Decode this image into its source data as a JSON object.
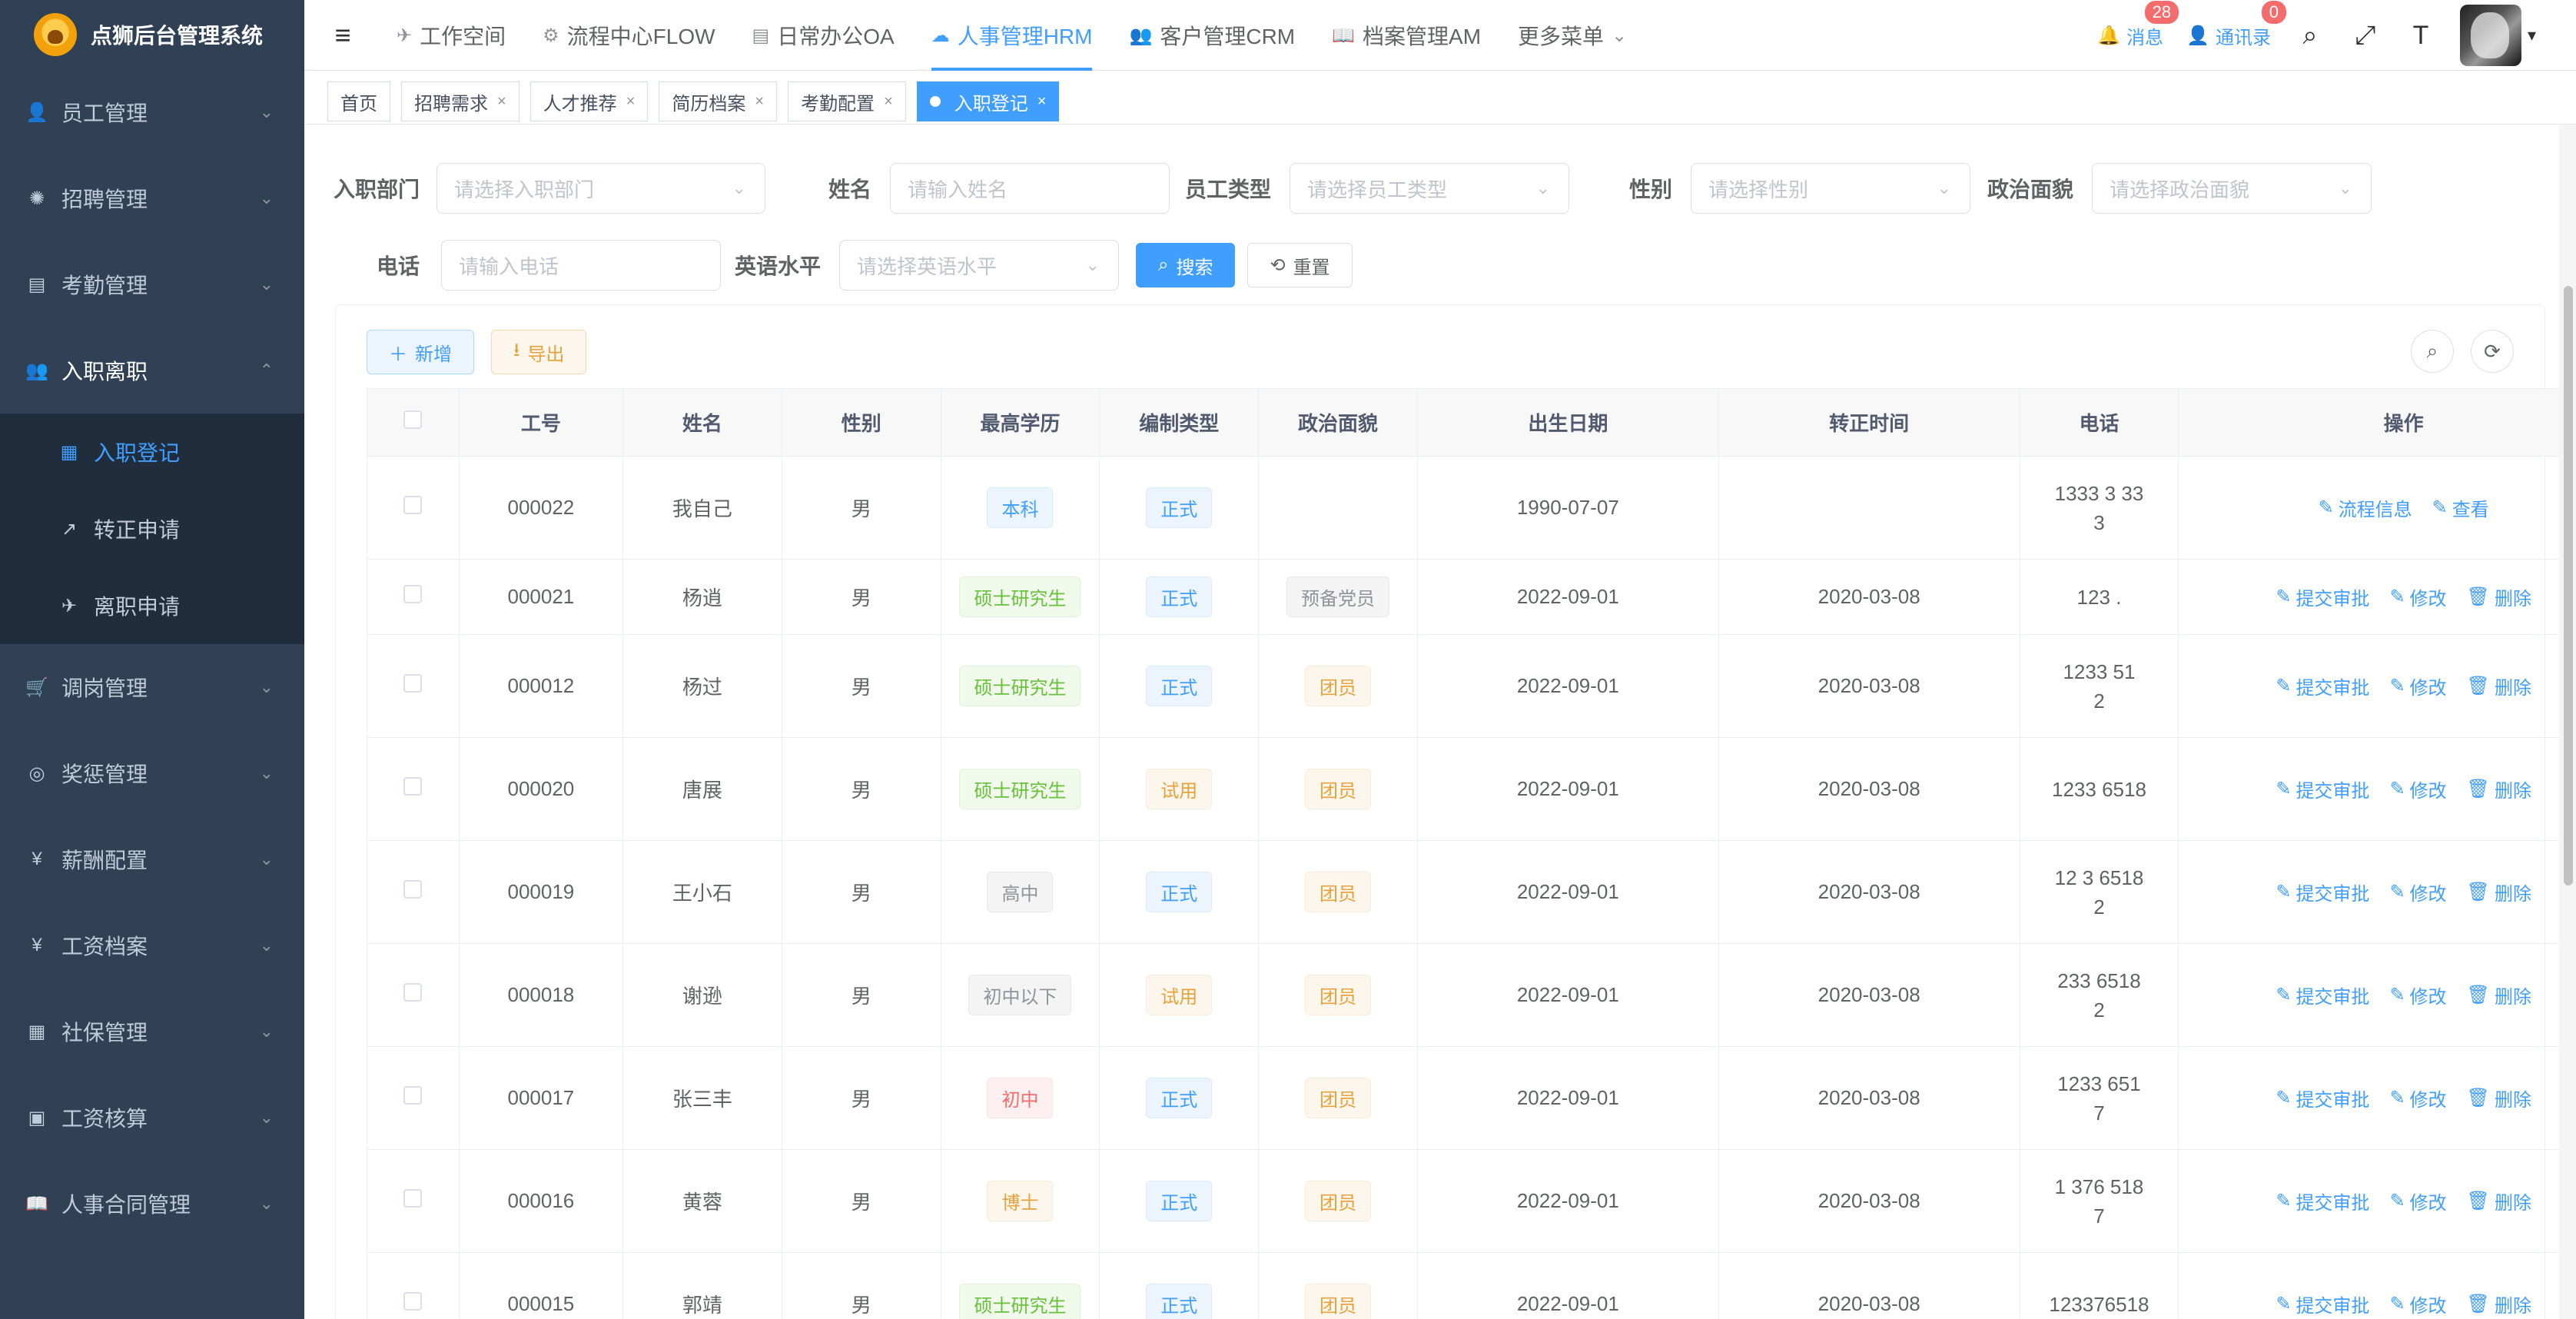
{
  "app": {
    "title": "点狮后台管理系统"
  },
  "sidebar": {
    "items": [
      {
        "label": "员工管理",
        "icon": "user-icon"
      },
      {
        "label": "招聘管理",
        "icon": "bug-icon"
      },
      {
        "label": "考勤管理",
        "icon": "form-icon"
      },
      {
        "label": "入职离职",
        "icon": "peoples-icon",
        "expanded": true,
        "children": [
          {
            "label": "入职登记",
            "icon": "calendar-icon",
            "active": true
          },
          {
            "label": "转正申请",
            "icon": "external-link-icon"
          },
          {
            "label": "离职申请",
            "icon": "paper-plane-icon"
          }
        ]
      },
      {
        "label": "调岗管理",
        "icon": "cart-icon"
      },
      {
        "label": "奖惩管理",
        "icon": "chrome-icon"
      },
      {
        "label": "薪酬配置",
        "icon": "yen-icon"
      },
      {
        "label": "工资档案",
        "icon": "yen-icon"
      },
      {
        "label": "社保管理",
        "icon": "grid-icon"
      },
      {
        "label": "工资核算",
        "icon": "calendar-icon"
      },
      {
        "label": "人事合同管理",
        "icon": "book-icon"
      }
    ]
  },
  "topnav": {
    "items": [
      {
        "label": "工作空间",
        "icon": "paper-plane-icon"
      },
      {
        "label": "流程中心FLOW",
        "icon": "flow-icon"
      },
      {
        "label": "日常办公OA",
        "icon": "doc-icon"
      },
      {
        "label": "人事管理HRM",
        "icon": "wechat-icon",
        "active": true
      },
      {
        "label": "客户管理CRM",
        "icon": "user-icon"
      },
      {
        "label": "档案管理AM",
        "icon": "book-icon"
      },
      {
        "label": "更多菜单",
        "icon": "chevron-down-icon"
      }
    ],
    "right": {
      "messages_label": "消息",
      "messages_badge": "28",
      "contacts_label": "通讯录",
      "contacts_badge": "0"
    }
  },
  "tags": [
    {
      "label": "首页",
      "closable": false
    },
    {
      "label": "招聘需求",
      "closable": true
    },
    {
      "label": "人才推荐",
      "closable": true
    },
    {
      "label": "简历档案",
      "closable": true
    },
    {
      "label": "考勤配置",
      "closable": true
    },
    {
      "label": "入职登记",
      "closable": true,
      "active": true
    }
  ],
  "search": {
    "dept_label": "入职部门",
    "dept_placeholder": "请选择入职部门",
    "name_label": "姓名",
    "name_placeholder": "请输入姓名",
    "type_label": "员工类型",
    "type_placeholder": "请选择员工类型",
    "gender_label": "性别",
    "gender_placeholder": "请选择性别",
    "politics_label": "政治面貌",
    "politics_placeholder": "请选择政治面貌",
    "phone_label": "电话",
    "phone_placeholder": "请输入电话",
    "english_label": "英语水平",
    "english_placeholder": "请选择英语水平",
    "search_button": "搜索",
    "reset_button": "重置"
  },
  "table_toolbar": {
    "add_button": "新增",
    "export_button": "导出"
  },
  "table": {
    "headers": [
      "工号",
      "姓名",
      "性别",
      "最高学历",
      "编制类型",
      "政治面貌",
      "出生日期",
      "转正时间",
      "电话",
      "操作"
    ],
    "rows": [
      {
        "id": "000022",
        "name": "我自己",
        "gender": "男",
        "education": "本科",
        "staff_type": "正式",
        "politics": "",
        "birth": "1990-07-07",
        "regular_date": "",
        "phone": "1333 3 33\n3",
        "ops": [
          "流程信息",
          "查看"
        ]
      },
      {
        "id": "000021",
        "name": "杨逍",
        "gender": "男",
        "education": "硕士研究生",
        "staff_type": "正式",
        "politics": "预备党员",
        "birth": "2022-09-01",
        "regular_date": "2020-03-08",
        "phone": "123 .",
        "ops": [
          "提交审批",
          "修改",
          "删除"
        ]
      },
      {
        "id": "000012",
        "name": "杨过",
        "gender": "男",
        "education": "硕士研究生",
        "staff_type": "正式",
        "politics": "团员",
        "birth": "2022-09-01",
        "regular_date": "2020-03-08",
        "phone": "1233 51\n2",
        "ops": [
          "提交审批",
          "修改",
          "删除"
        ]
      },
      {
        "id": "000020",
        "name": "唐展",
        "gender": "男",
        "education": "硕士研究生",
        "staff_type": "试用",
        "politics": "团员",
        "birth": "2022-09-01",
        "regular_date": "2020-03-08",
        "phone": "1233 6518",
        "ops": [
          "提交审批",
          "修改",
          "删除"
        ]
      },
      {
        "id": "000019",
        "name": "王小石",
        "gender": "男",
        "education": "高中",
        "staff_type": "正式",
        "politics": "团员",
        "birth": "2022-09-01",
        "regular_date": "2020-03-08",
        "phone": "12 3 6518\n2",
        "ops": [
          "提交审批",
          "修改",
          "删除"
        ]
      },
      {
        "id": "000018",
        "name": "谢逊",
        "gender": "男",
        "education": "初中以下",
        "staff_type": "试用",
        "politics": "团员",
        "birth": "2022-09-01",
        "regular_date": "2020-03-08",
        "phone": "233 6518\n2",
        "ops": [
          "提交审批",
          "修改",
          "删除"
        ]
      },
      {
        "id": "000017",
        "name": "张三丰",
        "gender": "男",
        "education": "初中",
        "staff_type": "正式",
        "politics": "团员",
        "birth": "2022-09-01",
        "regular_date": "2020-03-08",
        "phone": "1233 651\n7",
        "ops": [
          "提交审批",
          "修改",
          "删除"
        ]
      },
      {
        "id": "000016",
        "name": "黄蓉",
        "gender": "男",
        "education": "博士",
        "staff_type": "正式",
        "politics": "团员",
        "birth": "2022-09-01",
        "regular_date": "2020-03-08",
        "phone": "1 376 518\n7",
        "ops": [
          "提交审批",
          "修改",
          "删除"
        ]
      },
      {
        "id": "000015",
        "name": "郭靖",
        "gender": "男",
        "education": "硕士研究生",
        "staff_type": "正式",
        "politics": "团员",
        "birth": "2022-09-01",
        "regular_date": "2020-03-08",
        "phone": "123376518",
        "ops": [
          "提交审批",
          "修改",
          "删除"
        ]
      }
    ]
  },
  "colors": {
    "sidebar_bg": "#304156",
    "accent": "#409eff"
  }
}
